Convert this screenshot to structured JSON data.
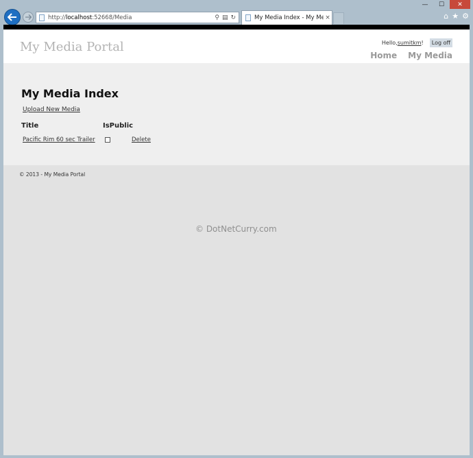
{
  "browser": {
    "url_prefix": "http://",
    "url_host": "localhost",
    "url_path": ":52668/Media",
    "tab_title": "My Media Index - My Medi...",
    "tab_close": "×",
    "controls": {
      "minimize": "—",
      "maximize": "☐",
      "close": "✕"
    },
    "toolbar": {
      "home": "⌂",
      "favorites": "★",
      "tools": "⚙"
    }
  },
  "site": {
    "title": "My Media Portal",
    "hello_prefix": "Hello, ",
    "username": "sumitkm",
    "hello_suffix": "!",
    "logoff": "Log off",
    "nav": [
      "Home",
      "My Media"
    ]
  },
  "page": {
    "heading": "My Media Index",
    "upload_link": "Upload New Media",
    "columns": [
      "Title",
      "IsPublic"
    ],
    "rows": [
      {
        "title": "Pacific Rim 60 sec Trailer",
        "is_public": false,
        "action": "Delete"
      }
    ]
  },
  "footer": {
    "copyright": "© 2013 - My Media Portal"
  },
  "watermark": "© DotNetCurry.com"
}
